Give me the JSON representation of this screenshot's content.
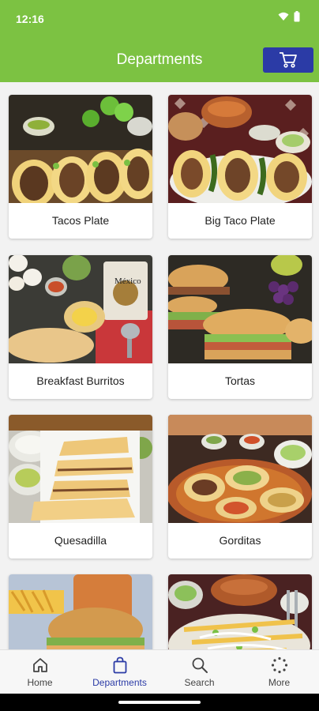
{
  "status": {
    "time": "12:16"
  },
  "header": {
    "title": "Departments"
  },
  "departments": [
    {
      "label": "Tacos Plate"
    },
    {
      "label": "Big Taco Plate"
    },
    {
      "label": "Breakfast Burritos"
    },
    {
      "label": "Tortas"
    },
    {
      "label": "Quesadilla"
    },
    {
      "label": "Gorditas"
    },
    {
      "label": ""
    },
    {
      "label": ""
    }
  ],
  "image_text": {
    "mexico_can": "México"
  },
  "nav": [
    {
      "label": "Home",
      "icon": "home-icon"
    },
    {
      "label": "Departments",
      "icon": "bag-icon"
    },
    {
      "label": "Search",
      "icon": "search-icon"
    },
    {
      "label": "More",
      "icon": "more-icon"
    }
  ],
  "colors": {
    "appbar": "#7cc242",
    "accent": "#2b3ba6"
  }
}
